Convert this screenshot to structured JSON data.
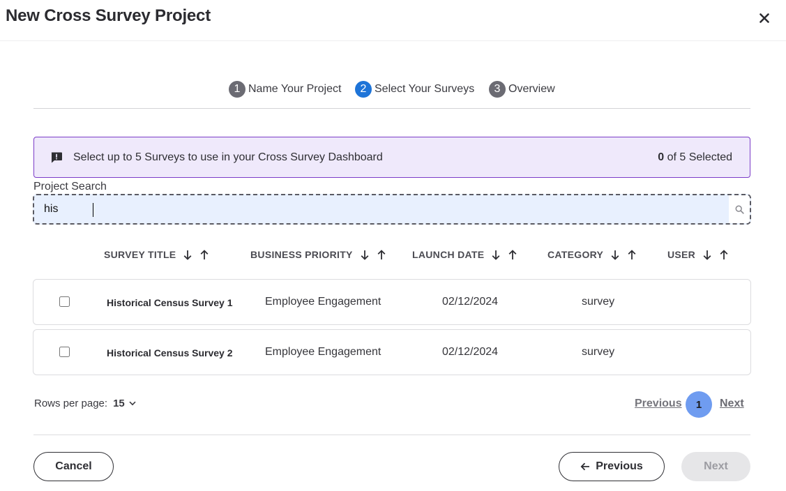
{
  "modal": {
    "title": "New Cross Survey Project",
    "close_icon": "close-icon"
  },
  "stepper": {
    "steps": [
      {
        "number": "1",
        "label": "Name Your Project",
        "state": "inactive"
      },
      {
        "number": "2",
        "label": "Select Your Surveys",
        "state": "active"
      },
      {
        "number": "3",
        "label": "Overview",
        "state": "inactive"
      }
    ]
  },
  "banner": {
    "icon": "message-alert-icon",
    "text": "Select up to 5 Surveys to use in your Cross Survey Dashboard",
    "selected_count": "0",
    "selected_suffix": "of 5 Selected"
  },
  "search": {
    "label": "Project Search",
    "value": "his",
    "icon": "search-icon"
  },
  "table": {
    "columns": [
      {
        "label": "SURVEY TITLE"
      },
      {
        "label": "BUSINESS PRIORITY"
      },
      {
        "label": "LAUNCH DATE"
      },
      {
        "label": "CATEGORY"
      },
      {
        "label": "USER"
      }
    ],
    "rows": [
      {
        "title": "Historical Census Survey 1",
        "priority": "Employee Engagement",
        "launch_date": "02/12/2024",
        "category": "survey",
        "user": "",
        "checked": false
      },
      {
        "title": "Historical Census Survey 2",
        "priority": "Employee Engagement",
        "launch_date": "02/12/2024",
        "category": "survey",
        "user": "",
        "checked": false
      }
    ]
  },
  "pagination": {
    "rows_per_page_label": "Rows per page:",
    "rows_per_page_value": "15",
    "previous_label": "Previous",
    "current_page": "1",
    "next_label": "Next"
  },
  "footer": {
    "cancel_label": "Cancel",
    "previous_label": "Previous",
    "next_label": "Next"
  },
  "colors": {
    "active_step": "#1e74d8",
    "banner_bg": "#efe9fb",
    "banner_border": "#7b3bc8",
    "current_page": "#6f9cf0"
  }
}
